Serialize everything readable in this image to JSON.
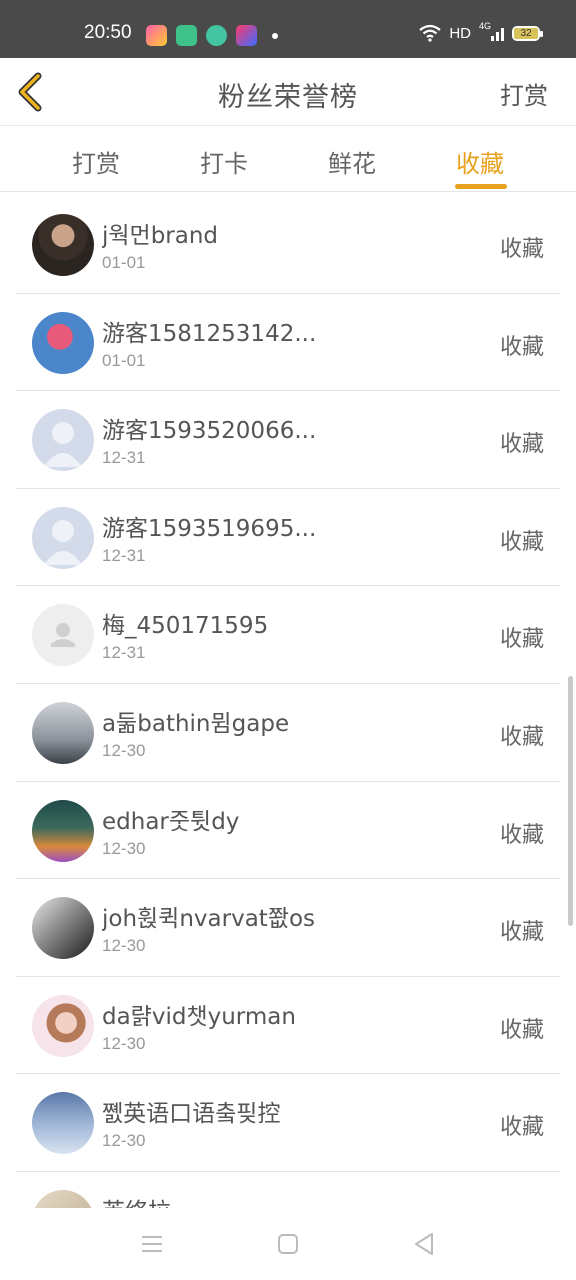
{
  "status_bar": {
    "time": "20:50",
    "network": "HD",
    "signal": "4G",
    "battery": "32",
    "app_icons": [
      "video-app-icon",
      "green-app-icon",
      "circle-app-icon",
      "media-app-icon"
    ]
  },
  "header": {
    "title": "粉丝荣誉榜",
    "action_label": "打赏"
  },
  "tabs": [
    {
      "label": "打赏"
    },
    {
      "label": "打卡"
    },
    {
      "label": "鲜花"
    },
    {
      "label": "收藏",
      "active": true
    }
  ],
  "list": [
    {
      "name": "j웍먼brand",
      "date": "01-01",
      "action": "收藏"
    },
    {
      "name": "游客1581253142...",
      "date": "01-01",
      "action": "收藏"
    },
    {
      "name": "游客1593520066...",
      "date": "12-31",
      "action": "收藏"
    },
    {
      "name": "游客1593519695...",
      "date": "12-31",
      "action": "收藏"
    },
    {
      "name": "梅_450171595",
      "date": "12-31",
      "action": "收藏"
    },
    {
      "name": "a둚bathin뮘gape",
      "date": "12-30",
      "action": "收藏"
    },
    {
      "name": "edhar줏튓dy",
      "date": "12-30",
      "action": "收藏"
    },
    {
      "name": "joh휝퀵nvarvat쫪os",
      "date": "12-30",
      "action": "收藏"
    },
    {
      "name": "da랽vid챗yurman",
      "date": "12-30",
      "action": "收藏"
    },
    {
      "name": "쪬英语口语춬핒控",
      "date": "12-30",
      "action": "收藏"
    },
    {
      "name": "芙络拉",
      "date": "",
      "action": ""
    }
  ],
  "colors": {
    "accent": "#e8a11c",
    "status_bar": "#4a4a4a"
  }
}
